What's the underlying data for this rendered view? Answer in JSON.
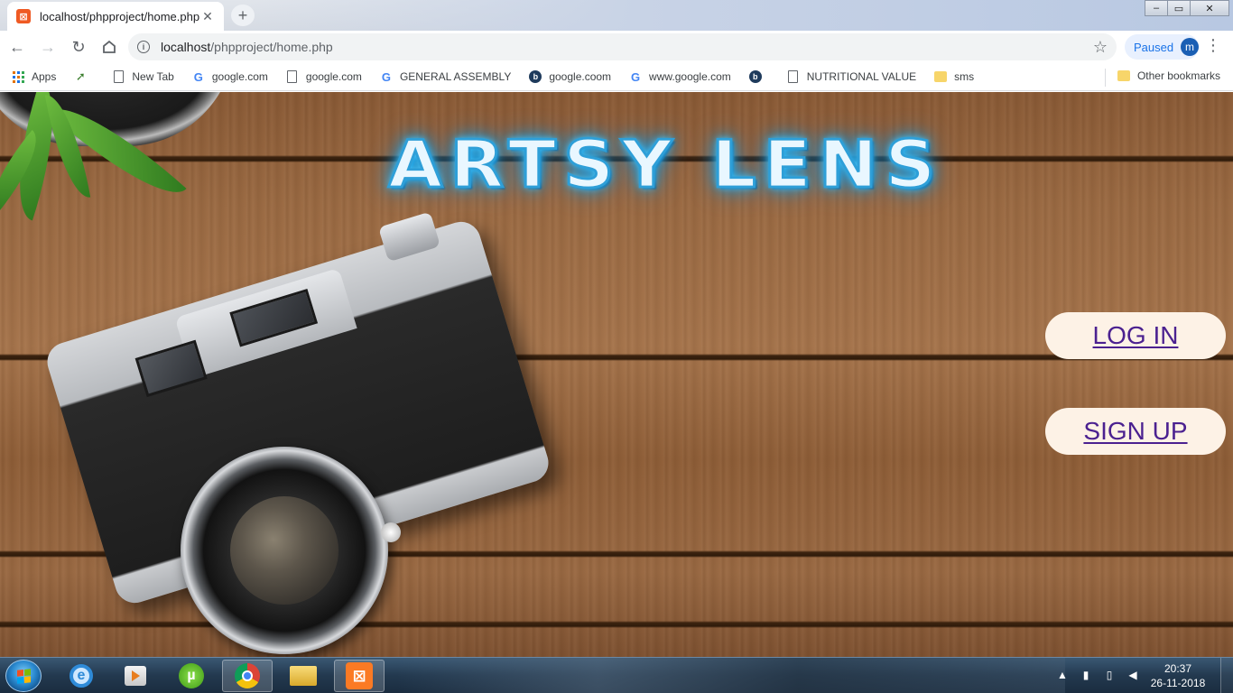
{
  "browser": {
    "tab": {
      "title": "localhost/phpproject/home.php",
      "favicon": "xampp-icon"
    },
    "new_tab_symbol": "+",
    "window_controls": {
      "minimize": "–",
      "restore": "▭",
      "close": "✕"
    },
    "address": {
      "host": "localhost",
      "path": "/phpproject/home.php"
    },
    "profile": {
      "status": "Paused",
      "avatar_letter": "m"
    },
    "bookmarks": [
      {
        "label": "Apps",
        "icon": "apps-grid-icon"
      },
      {
        "label": "",
        "icon": "arrow-favicon-icon"
      },
      {
        "label": "New Tab",
        "icon": "page-icon"
      },
      {
        "label": "google.com",
        "icon": "google-icon"
      },
      {
        "label": "google.com",
        "icon": "page-icon"
      },
      {
        "label": "GENERAL ASSEMBLY",
        "icon": "google-icon"
      },
      {
        "label": "google.coom",
        "icon": "b-favicon-icon"
      },
      {
        "label": "www.google.com",
        "icon": "google-icon"
      },
      {
        "label": "",
        "icon": "b-favicon-icon"
      },
      {
        "label": "NUTRITIONAL VALUE",
        "icon": "page-icon"
      },
      {
        "label": "sms",
        "icon": "folder-icon"
      }
    ],
    "other_bookmarks": "Other bookmarks"
  },
  "page": {
    "site_title": "ARTSY LENS",
    "login_label": "LOG IN",
    "signup_label": "SIGN UP"
  },
  "taskbar": {
    "apps": [
      "internet-explorer",
      "media-player",
      "utorrent",
      "chrome",
      "file-explorer",
      "xampp"
    ],
    "active_apps": [
      "chrome",
      "xampp"
    ],
    "clock": {
      "time": "20:37",
      "date": "26-11-2018"
    }
  },
  "colors": {
    "button_bg": "#fdf2e6",
    "button_text": "#4b2190",
    "title_glow": "#1aa3e8",
    "wood": "#9b6a42"
  }
}
